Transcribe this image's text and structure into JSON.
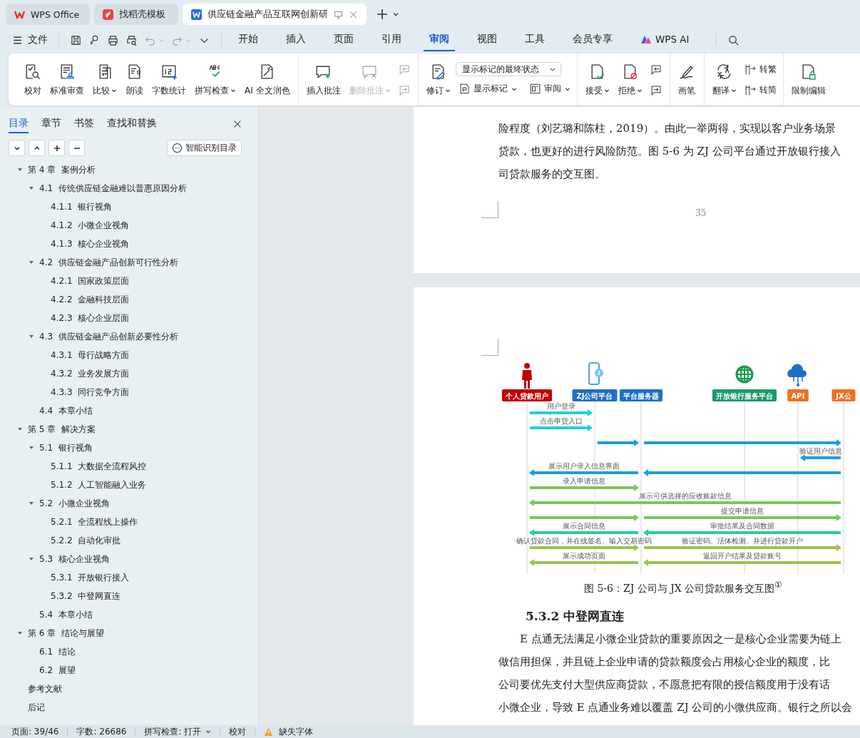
{
  "title_tabs": [
    {
      "label": "WPS Office",
      "kind": "wps",
      "selected": false
    },
    {
      "label": "找稻壳模板",
      "kind": "docer",
      "selected": false
    },
    {
      "label": "供应链金融产品互联网创新研",
      "kind": "doc",
      "selected": true
    }
  ],
  "menu": {
    "file": "文件",
    "tabs": [
      {
        "label": "开始",
        "kind": "text",
        "selected": false
      },
      {
        "label": "插入",
        "kind": "text",
        "selected": false
      },
      {
        "label": "页面",
        "kind": "text",
        "selected": false
      },
      {
        "label": "引用",
        "kind": "text",
        "selected": false
      },
      {
        "label": "审阅",
        "kind": "text",
        "selected": true
      },
      {
        "label": "视图",
        "kind": "text",
        "selected": false
      },
      {
        "label": "工具",
        "kind": "text",
        "selected": false
      },
      {
        "label": "会员专享",
        "kind": "text",
        "selected": false
      },
      {
        "label": "WPS AI",
        "kind": "ai",
        "selected": false
      }
    ]
  },
  "ribbon": {
    "groups": [
      {
        "columns": [
          {
            "items": [
              {
                "kind": "large",
                "label": "校对",
                "caret": false,
                "disabled": false
              }
            ]
          },
          {
            "items": [
              {
                "kind": "large",
                "label": "标准审查",
                "caret": false,
                "disabled": false
              }
            ]
          },
          {
            "items": [
              {
                "kind": "large",
                "label": "比较",
                "caret": true,
                "disabled": false
              }
            ]
          },
          {
            "items": [
              {
                "kind": "large",
                "label": "朗读",
                "caret": false,
                "disabled": false
              }
            ]
          },
          {
            "items": [
              {
                "kind": "large",
                "label": "字数统计",
                "caret": false,
                "disabled": false
              }
            ]
          },
          {
            "items": [
              {
                "kind": "large",
                "label": "拼写检查",
                "caret": true,
                "disabled": false
              }
            ]
          },
          {
            "items": [
              {
                "kind": "large",
                "label": "AI 全文润色",
                "caret": false,
                "disabled": false
              }
            ]
          }
        ]
      },
      {
        "columns": [
          {
            "items": [
              {
                "kind": "large",
                "label": "插入批注",
                "caret": false,
                "disabled": false
              }
            ]
          },
          {
            "items": [
              {
                "kind": "large",
                "label": "删除批注",
                "caret": true,
                "disabled": true
              }
            ]
          },
          {
            "items": [
              {
                "kind": "icon",
                "caret": false,
                "disabled": true
              },
              {
                "kind": "icon",
                "caret": false,
                "disabled": true
              }
            ]
          }
        ]
      },
      {
        "columns": [
          {
            "items": [
              {
                "kind": "large",
                "label": "修订",
                "caret": true,
                "disabled": false
              }
            ]
          },
          {
            "items": [
              {
                "kind": "select",
                "value": "显示标记的最终状态"
              },
              {
                "kind": "row",
                "items": [
                  {
                    "kind": "small",
                    "label": "显示标记",
                    "caret": true,
                    "disabled": false
                  },
                  {
                    "kind": "small",
                    "label": "审阅",
                    "caret": true,
                    "disabled": false
                  }
                ]
              }
            ]
          }
        ]
      },
      {
        "columns": [
          {
            "items": [
              {
                "kind": "large",
                "label": "接受",
                "caret": true,
                "disabled": false
              }
            ]
          },
          {
            "items": [
              {
                "kind": "large",
                "label": "拒绝",
                "caret": true,
                "disabled": false
              }
            ]
          },
          {
            "items": [
              {
                "kind": "icon",
                "caret": false,
                "disabled": false
              },
              {
                "kind": "icon",
                "caret": false,
                "disabled": false
              }
            ]
          }
        ]
      },
      {
        "columns": [
          {
            "items": [
              {
                "kind": "large",
                "label": "画笔",
                "caret": false,
                "disabled": false
              }
            ]
          }
        ]
      },
      {
        "columns": [
          {
            "items": [
              {
                "kind": "large",
                "label": "翻译",
                "caret": true,
                "disabled": false
              }
            ]
          },
          {
            "items": [
              {
                "kind": "small",
                "label": "转繁",
                "caret": false,
                "disabled": false
              },
              {
                "kind": "small",
                "label": "转简",
                "caret": false,
                "disabled": false
              }
            ]
          }
        ]
      },
      {
        "columns": [
          {
            "items": [
              {
                "kind": "large",
                "label": "限制编辑",
                "caret": false,
                "disabled": false
              }
            ]
          }
        ]
      }
    ]
  },
  "toc": {
    "tabs": [
      {
        "label": "目录",
        "selected": true
      },
      {
        "label": "章节",
        "selected": false
      },
      {
        "label": "书签",
        "selected": false
      },
      {
        "label": "查找和替换",
        "selected": false
      }
    ],
    "smart_button": "智能识别目录",
    "items": [
      {
        "label": "第 4 章  案例分析",
        "expanded": true,
        "children": [
          {
            "label": "4.1  传统供应链金融难以普惠原因分析",
            "expanded": true,
            "children": [
              {
                "label": "4.1.1  银行视角"
              },
              {
                "label": "4.1.2  小微企业视角"
              },
              {
                "label": "4.1.3  核心企业视角"
              }
            ]
          },
          {
            "label": "4.2  供应链金融产品创新可行性分析",
            "expanded": true,
            "children": [
              {
                "label": "4.2.1  国家政策层面"
              },
              {
                "label": "4.2.2  金融科技层面"
              },
              {
                "label": "4.2.3  核心企业层面"
              }
            ]
          },
          {
            "label": "4.3  供应链金融产品创新必要性分析",
            "expanded": true,
            "children": [
              {
                "label": "4.3.1  母行战略方面"
              },
              {
                "label": "4.3.2  业务发展方面"
              },
              {
                "label": "4.3.3  同行竞争方面"
              }
            ]
          },
          {
            "label": "4.4  本章小结"
          }
        ]
      },
      {
        "label": "第 5 章  解决方案",
        "expanded": true,
        "children": [
          {
            "label": "5.1  银行视角",
            "expanded": true,
            "children": [
              {
                "label": "5.1.1  大数据全流程风控"
              },
              {
                "label": "5.1.2  人工智能融入业务"
              }
            ]
          },
          {
            "label": "5.2  小微企业视角",
            "expanded": true,
            "children": [
              {
                "label": "5.2.1  全流程线上操作"
              },
              {
                "label": "5.2.2  自动化审批"
              }
            ]
          },
          {
            "label": "5.3  核心企业视角",
            "expanded": true,
            "children": [
              {
                "label": "5.3.1  开放银行接入"
              },
              {
                "label": "5.3.2  中登网直连"
              }
            ]
          },
          {
            "label": "5.4  本章小结"
          }
        ]
      },
      {
        "label": "第 6 章  结论与展望",
        "expanded": true,
        "children": [
          {
            "label": "6.1  结论"
          },
          {
            "label": "6.2  展望"
          }
        ]
      },
      {
        "label": "参考文献"
      },
      {
        "label": "后记"
      }
    ]
  },
  "document": {
    "page_1": {
      "lines": [
        "险程度（刘艺璐和陈柱，2019）。由此一举两得，实现以客户业务场景",
        "贷款，也更好的进行风险防范。图 5-6 为 ZJ 公司平台通过开放银行接入",
        "司贷款服务的交互图。"
      ],
      "page_number": "35"
    },
    "page_2": {
      "figure": {
        "participants": [
          {
            "label": "个人贷款用户",
            "color": "#c00000"
          },
          {
            "label": "ZJ公司平台",
            "color": "#1f6fc5"
          },
          {
            "label": "平台服务器",
            "color": "#1f6fc5"
          },
          {
            "label": "开放银行服务平台",
            "color": "#1a9a6a"
          },
          {
            "label": "API",
            "color": "#f07020"
          },
          {
            "label": "JX公",
            "color": "#f07020"
          }
        ],
        "rows": [
          {
            "arrows": [
              {
                "label": "用户登录",
                "color": "#1fd0dc"
              }
            ]
          },
          {
            "arrows": [
              {
                "label": "点击申贷入口",
                "color": "#1fd0dc"
              }
            ]
          },
          {
            "arrows": [
              {
                "color": "#1a9ee0"
              },
              {
                "color": "#1a9ee0"
              }
            ]
          },
          {
            "arrows": [
              {
                "label": "验证用户信息",
                "color": "#1a9ee0"
              }
            ]
          },
          {
            "arrows": [
              {
                "label": "展示用户录入信息界面",
                "color": "#1a9ee0"
              },
              {
                "color": "#1a9ee0"
              }
            ]
          },
          {
            "arrows": [
              {
                "label": "录入申请信息",
                "color": "#78c85a"
              }
            ]
          },
          {
            "arrows": [
              {
                "label": "展示可供选择的应收账款信息",
                "color": "#78c85a"
              }
            ]
          },
          {
            "arrows": [
              {
                "color": "#78c85a"
              },
              {
                "label": "提交申请信息",
                "color": "#78c85a"
              }
            ]
          },
          {
            "arrows": [
              {
                "label": "展示合同信息",
                "color": "#22d0a0"
              },
              {
                "label": "审批结果及合同数据",
                "color": "#22d0a0"
              }
            ]
          },
          {
            "arrows": [
              {
                "label": "确认贷款合同，并在线签名、输入交易密码",
                "color": "#9cc24a"
              },
              {
                "label": "验证密码、活体检测、并进行贷款开户",
                "color": "#9cc24a"
              }
            ]
          },
          {
            "arrows": [
              {
                "label": "展示成功页面",
                "color": "#9cc24a"
              },
              {
                "label": "返回开户结果及贷款账号",
                "color": "#9cc24a"
              }
            ]
          }
        ]
      },
      "caption": "图 5-6：ZJ 公司与 JX 公司贷款服务交互图$^{①}$",
      "heading": "5.3.2 中登网直连",
      "lines": [
        "E 点通无法满足小微企业贷款的重要原因之一是核心企业需要为链上",
        "做信用担保，并且链上企业申请的贷款额度会占用核心企业的额度，比",
        "公司要优先支付大型供应商贷款，不愿意把有限的授信额度用于没有话",
        "小微企业，导致 E 点通业务难以覆盖 ZJ 公司的小微供应商。银行之所以会"
      ]
    }
  },
  "status_bar": [
    {
      "kind": "text",
      "label": "页面: 39/46"
    },
    {
      "kind": "text",
      "label": "字数: 26686"
    },
    {
      "kind": "dropdown",
      "label": "拼写检查: 打开"
    },
    {
      "kind": "text",
      "label": "校对"
    },
    {
      "kind": "warning",
      "label": "缺失字体"
    }
  ]
}
